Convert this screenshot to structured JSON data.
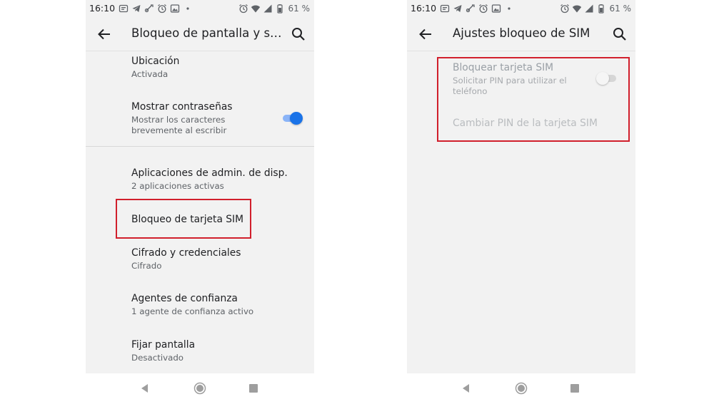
{
  "status_bar": {
    "time": "16:10",
    "battery_text": "61 %"
  },
  "left_screen": {
    "title": "Bloqueo de pantalla y se…",
    "items": [
      {
        "title": "Ubicación",
        "subtitle": "Activada"
      },
      {
        "title": "Mostrar contraseñas",
        "subtitle": "Mostrar los caracteres brevemente al escribir",
        "toggle": true
      },
      {
        "title": "Aplicaciones de admin. de disp.",
        "subtitle": "2 aplicaciones activas"
      },
      {
        "title": "Bloqueo de tarjeta SIM"
      },
      {
        "title": "Cifrado y credenciales",
        "subtitle": "Cifrado"
      },
      {
        "title": "Agentes de confianza",
        "subtitle": "1 agente de confianza activo"
      },
      {
        "title": "Fijar pantalla",
        "subtitle": "Desactivado"
      }
    ]
  },
  "right_screen": {
    "title": "Ajustes bloqueo de SIM",
    "items": [
      {
        "title": "Bloquear tarjeta SIM",
        "subtitle": "Solicitar PIN para utilizar el teléfono",
        "toggle": false
      },
      {
        "title": "Cambiar PIN de la tarjeta SIM"
      }
    ]
  },
  "colors": {
    "accent": "#1a73e8",
    "highlight_box": "#d11f2c",
    "screen_background": "#f2f2f2"
  },
  "icons": {
    "status_left": [
      "google-news-icon",
      "telegram-icon",
      "link-icon",
      "alarm-icon",
      "gallery-icon",
      "dot-icon"
    ],
    "status_right": [
      "alarm-icon",
      "wifi-icon",
      "signal-icon",
      "battery-icon"
    ],
    "app_bar": [
      "back-arrow-icon",
      "search-icon"
    ],
    "nav": [
      "back-triangle-icon",
      "home-circle-icon",
      "recents-square-icon"
    ]
  }
}
